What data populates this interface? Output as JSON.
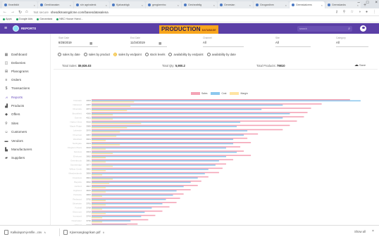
{
  "browser": {
    "tabs": [
      {
        "label": "Kearifalkt"
      },
      {
        "label": "Geekhanakm"
      },
      {
        "label": "shr agrivalenk"
      },
      {
        "label": "Kjaharahigk"
      },
      {
        "label": "gengkeerinc"
      },
      {
        "label": "Gesheafelig"
      },
      {
        "label": "Genesian"
      },
      {
        "label": "Geogardinm"
      },
      {
        "label": "Geenskalcens"
      },
      {
        "label": "Geenskanks"
      }
    ],
    "new_tab": "+",
    "window_controls": {
      "minimize": "–",
      "maximize": "□",
      "close": "×"
    },
    "address": {
      "not_secure": "Not secure",
      "url": "shesdkmasngdcme.com/basesdatasalena"
    },
    "bookmarks": [
      "Apps",
      "Google Ads",
      "Ganantara",
      "NBC House Hand..."
    ]
  },
  "app": {
    "name": "REPORTS",
    "brand": "PRODUCTION",
    "brand_sub": "DATABASE",
    "search_placeholder": "search",
    "colors": {
      "header": "#5b3fa6",
      "accent": "#f7a51c"
    }
  },
  "sidebar": {
    "items": [
      {
        "label": "Dashboard",
        "icon": "dashboard-icon",
        "glyph": "▦"
      },
      {
        "label": "Deliveries",
        "icon": "box-icon",
        "glyph": "◫"
      },
      {
        "label": "Planograms",
        "icon": "grid-icon",
        "glyph": "⊞"
      },
      {
        "label": "Orders",
        "icon": "list-icon",
        "glyph": "≡"
      },
      {
        "label": "Transactions",
        "icon": "dollar-icon",
        "glyph": "$"
      },
      {
        "label": "Reports",
        "icon": "chart-icon",
        "glyph": "⩘"
      },
      {
        "label": "Products",
        "icon": "products-icon",
        "glyph": "▟"
      },
      {
        "label": "Offers",
        "icon": "tag-icon",
        "glyph": "◆"
      },
      {
        "label": "Sites",
        "icon": "location-icon",
        "glyph": "⚲"
      },
      {
        "label": "Customers",
        "icon": "people-icon",
        "glyph": "☺"
      },
      {
        "label": "Vendors",
        "icon": "vendor-icon",
        "glyph": "▬"
      },
      {
        "label": "Manufacturers",
        "icon": "factory-icon",
        "glyph": "▙"
      },
      {
        "label": "Suppliers",
        "icon": "truck-icon",
        "glyph": "▰"
      }
    ],
    "active_index": 5
  },
  "filters": [
    {
      "label": "Start Date",
      "value": "8/25/2019",
      "has_calendar": true
    },
    {
      "label": "End Date",
      "value": "11/24/2019",
      "has_calendar": true
    },
    {
      "label": "Channel",
      "value": "All",
      "has_calendar": false
    },
    {
      "label": "Site",
      "value": "All",
      "has_calendar": false
    },
    {
      "label": "Category",
      "value": "All",
      "has_calendar": false
    }
  ],
  "report_options": [
    {
      "label": "sales by date",
      "selected": false
    },
    {
      "label": "sales by product",
      "selected": false
    },
    {
      "label": "sales by endpoint",
      "selected": true
    },
    {
      "label": "stock levels",
      "selected": false
    },
    {
      "label": "availability by endpoint",
      "selected": false
    },
    {
      "label": "availability by date",
      "selected": false
    }
  ],
  "totals": {
    "sales_label": "Total Sales:",
    "sales_value": "$9,926.03",
    "qty_label": "Total Qty:",
    "qty_value": "5,900.2",
    "products_label": "Total Products:",
    "products_value": "79810"
  },
  "save_label": "Save",
  "chart_data": {
    "type": "bar",
    "orientation": "horizontal",
    "series": [
      {
        "name": "Sales",
        "color": "#f4a4b6",
        "values": [
          730,
          650,
          620,
          610,
          600,
          580,
          560,
          540,
          470,
          440,
          450,
          420,
          430,
          450,
          400,
          380,
          370,
          360,
          330,
          310,
          300,
          280,
          260,
          250,
          240,
          220,
          200,
          180,
          160,
          130,
          110
        ]
      },
      {
        "name": "Cost",
        "color": "#8cc8ee",
        "values": [
          760,
          540,
          480,
          560,
          540,
          420,
          410,
          440,
          430,
          400,
          400,
          380,
          410,
          380,
          360,
          350,
          330,
          320,
          300,
          280,
          260,
          240,
          230,
          210,
          200,
          170,
          150,
          140,
          110,
          100,
          80
        ]
      },
      {
        "name": "Margin",
        "color": "#ffe4a2",
        "values": [
          120,
          110,
          100,
          60,
          60,
          140,
          100,
          80,
          70,
          40,
          80,
          40,
          60,
          40,
          40,
          60,
          40,
          30,
          60,
          50,
          40,
          40,
          30,
          40,
          40,
          30,
          40,
          30,
          30,
          20,
          20
        ]
      }
    ],
    "categories": [
      "4093",
      "4087",
      "4071",
      "4066",
      "4021",
      "4016",
      "3985",
      "3970",
      "3957",
      "3941",
      "3923",
      "3916",
      "3904",
      "3892",
      "3881",
      "3877",
      "3862",
      "3856",
      "3841",
      "3832",
      "3827",
      "3815",
      "3806",
      "3792",
      "3781",
      "3768",
      "3754",
      "3743",
      "3730",
      "3719",
      "3705"
    ],
    "category_names": [
      "Cascade",
      "Oakwood",
      "Riverside",
      "Brookfield",
      "Summit",
      "Harbor View",
      "Maple Ridge",
      "Lakeside",
      "Pinecrest",
      "Westfield",
      "Northgate",
      "Kingston Plaza",
      "Fairview",
      "Elmhurst",
      "Greenbrook",
      "Stonebridge",
      "Willow Creek",
      "Meadowlands",
      "Crestview",
      "Bayside",
      "Ashford",
      "Highland",
      "Parkside",
      "Redwood",
      "Silverlake",
      "Foxhall",
      "Glenmont",
      "Ironwood",
      "Clearwater",
      "Hillcrest",
      "Sunview"
    ],
    "xlim": [
      0,
      800
    ]
  },
  "downloads": [
    {
      "label": "Kalkulaport-jemfile...csv"
    },
    {
      "label": "Kjsensangkagrikam.pdf"
    }
  ],
  "show_all": "Show all",
  "dl_close": "×"
}
